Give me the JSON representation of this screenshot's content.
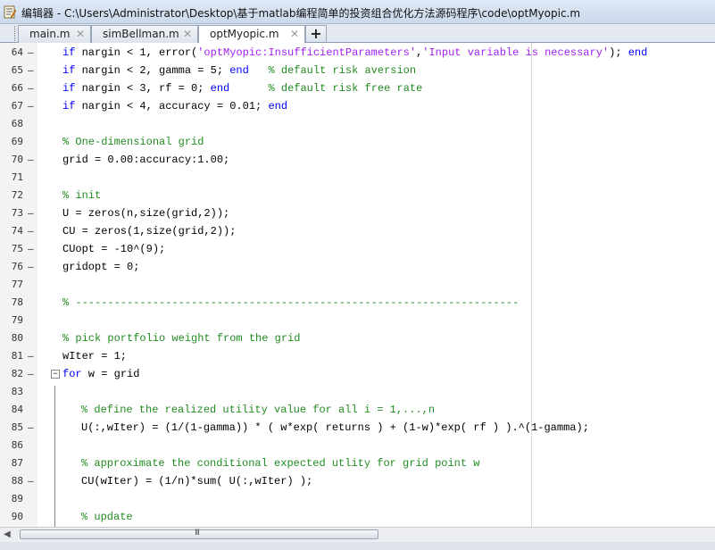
{
  "window": {
    "title": "编辑器 - C:\\Users\\Administrator\\Desktop\\基于matlab编程简单的投资组合优化方法源码程序\\code\\optMyopic.m"
  },
  "tabs": [
    {
      "label": "main.m",
      "close": "✕",
      "active": false
    },
    {
      "label": "simBellman.m",
      "close": "✕",
      "active": false
    },
    {
      "label": "optMyopic.m",
      "close": "✕",
      "active": true
    }
  ],
  "add_tab_label": "+",
  "scrollbar": {
    "grip": "III"
  },
  "lines": [
    {
      "num": "64",
      "mark": "—",
      "indent": 0,
      "tokens": [
        {
          "t": "if",
          "c": "kw"
        },
        {
          "t": " nargin < 1, error(",
          "c": ""
        },
        {
          "t": "'optMyopic:InsufficientParameters'",
          "c": "str"
        },
        {
          "t": ",",
          "c": ""
        },
        {
          "t": "'Input variable is necessary'",
          "c": "str"
        },
        {
          "t": "); ",
          "c": ""
        },
        {
          "t": "end",
          "c": "kw"
        }
      ]
    },
    {
      "num": "65",
      "mark": "—",
      "indent": 0,
      "tokens": [
        {
          "t": "if",
          "c": "kw"
        },
        {
          "t": " nargin < 2, gamma = 5; ",
          "c": ""
        },
        {
          "t": "end",
          "c": "kw"
        },
        {
          "t": "   ",
          "c": ""
        },
        {
          "t": "% default risk aversion",
          "c": "cm"
        }
      ]
    },
    {
      "num": "66",
      "mark": "—",
      "indent": 0,
      "tokens": [
        {
          "t": "if",
          "c": "kw"
        },
        {
          "t": " nargin < 3, rf = 0; ",
          "c": ""
        },
        {
          "t": "end",
          "c": "kw"
        },
        {
          "t": "      ",
          "c": ""
        },
        {
          "t": "% default risk free rate",
          "c": "cm"
        }
      ]
    },
    {
      "num": "67",
      "mark": "—",
      "indent": 0,
      "tokens": [
        {
          "t": "if",
          "c": "kw"
        },
        {
          "t": " nargin < 4, accuracy = 0.01; ",
          "c": ""
        },
        {
          "t": "end",
          "c": "kw"
        }
      ]
    },
    {
      "num": "68",
      "mark": "",
      "indent": 0,
      "tokens": []
    },
    {
      "num": "69",
      "mark": "",
      "indent": 0,
      "tokens": [
        {
          "t": "% One-dimensional grid",
          "c": "cm"
        }
      ]
    },
    {
      "num": "70",
      "mark": "—",
      "indent": 0,
      "tokens": [
        {
          "t": "grid = 0.00:accuracy:1.00;",
          "c": ""
        }
      ]
    },
    {
      "num": "71",
      "mark": "",
      "indent": 0,
      "tokens": []
    },
    {
      "num": "72",
      "mark": "",
      "indent": 0,
      "tokens": [
        {
          "t": "% init",
          "c": "cm"
        }
      ]
    },
    {
      "num": "73",
      "mark": "—",
      "indent": 0,
      "tokens": [
        {
          "t": "U = zeros(n,size(grid,2));",
          "c": ""
        }
      ]
    },
    {
      "num": "74",
      "mark": "—",
      "indent": 0,
      "tokens": [
        {
          "t": "CU = zeros(1,size(grid,2));",
          "c": ""
        }
      ]
    },
    {
      "num": "75",
      "mark": "—",
      "indent": 0,
      "tokens": [
        {
          "t": "CUopt = -10^(9);",
          "c": ""
        }
      ]
    },
    {
      "num": "76",
      "mark": "—",
      "indent": 0,
      "tokens": [
        {
          "t": "gridopt = 0;",
          "c": ""
        }
      ]
    },
    {
      "num": "77",
      "mark": "",
      "indent": 0,
      "tokens": []
    },
    {
      "num": "78",
      "mark": "",
      "indent": 0,
      "tokens": [
        {
          "t": "% ---------------------------------------------------------------------",
          "c": "cm"
        }
      ]
    },
    {
      "num": "79",
      "mark": "",
      "indent": 0,
      "tokens": []
    },
    {
      "num": "80",
      "mark": "",
      "indent": 0,
      "tokens": [
        {
          "t": "% pick portfolio weight from the grid",
          "c": "cm"
        }
      ]
    },
    {
      "num": "81",
      "mark": "—",
      "indent": 0,
      "tokens": [
        {
          "t": "wIter = 1;",
          "c": ""
        }
      ]
    },
    {
      "num": "82",
      "mark": "—",
      "indent": 0,
      "fold": "−",
      "tokens": [
        {
          "t": "for",
          "c": "kw"
        },
        {
          "t": " w = grid",
          "c": ""
        }
      ]
    },
    {
      "num": "83",
      "mark": "",
      "indent": 1,
      "tokens": []
    },
    {
      "num": "84",
      "mark": "",
      "indent": 1,
      "tokens": [
        {
          "t": "% define the realized utility value for all i = 1,...,n",
          "c": "cm"
        }
      ]
    },
    {
      "num": "85",
      "mark": "—",
      "indent": 1,
      "tokens": [
        {
          "t": "U(:,wIter) = (1/(1-gamma)) * ( w*exp( returns ) + (1-w)*exp( rf ) ).^(1-gamma);",
          "c": ""
        }
      ]
    },
    {
      "num": "86",
      "mark": "",
      "indent": 1,
      "tokens": []
    },
    {
      "num": "87",
      "mark": "",
      "indent": 1,
      "tokens": [
        {
          "t": "% approximate the conditional expected utlity for grid point w",
          "c": "cm"
        }
      ]
    },
    {
      "num": "88",
      "mark": "—",
      "indent": 1,
      "tokens": [
        {
          "t": "CU(wIter) = (1/n)*sum( U(:,wIter) );",
          "c": ""
        }
      ]
    },
    {
      "num": "89",
      "mark": "",
      "indent": 1,
      "tokens": []
    },
    {
      "num": "90",
      "mark": "",
      "indent": 1,
      "tokens": [
        {
          "t": "% update",
          "c": "cm"
        }
      ]
    }
  ]
}
